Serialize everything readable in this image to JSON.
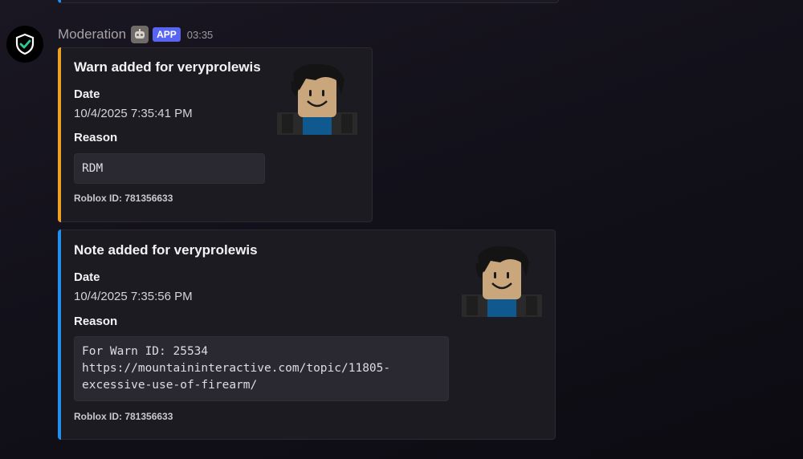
{
  "message": {
    "author": "Moderation",
    "badge": "APP",
    "time": "03:35",
    "avatar_icon": "shield-check-icon",
    "bot_icon": "robot-icon"
  },
  "embeds": [
    {
      "title": "Warn added for veryprolewis",
      "accent": "#f0a020",
      "fields": [
        {
          "name": "Date",
          "value": "10/4/2025 7:35:41 PM"
        },
        {
          "name": "Reason",
          "value": "RDM"
        }
      ],
      "footer": "Roblox ID: 781356633"
    },
    {
      "title": "Note added for veryprolewis",
      "accent": "#1f8ff2",
      "fields": [
        {
          "name": "Date",
          "value": "10/4/2025 7:35:56 PM"
        },
        {
          "name": "Reason",
          "value": "For Warn ID: 25534\nhttps://mountaininteractive.com/topic/11805-\nexcessive-use-of-firearm/"
        }
      ],
      "footer": "Roblox ID: 781356633"
    }
  ]
}
